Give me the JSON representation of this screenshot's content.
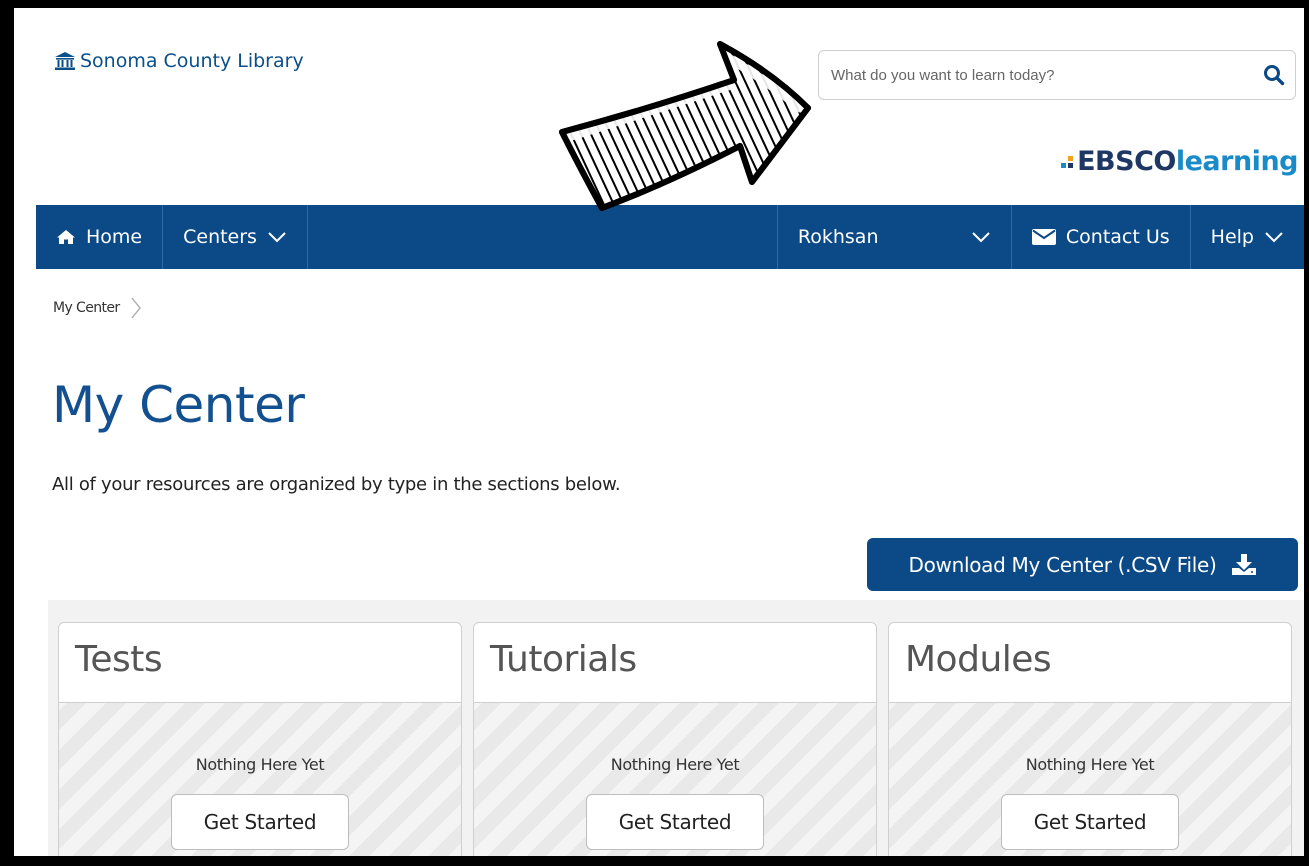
{
  "header": {
    "library_name": "Sonoma County Library",
    "search_placeholder": "What do you want to learn today?",
    "brand_prefix": "EBSCO",
    "brand_suffix": "learning"
  },
  "nav": {
    "home": "Home",
    "centers": "Centers",
    "user": "Rokhsan",
    "contact": "Contact Us",
    "help": "Help"
  },
  "breadcrumb": {
    "current": "My Center"
  },
  "page": {
    "title": "My Center",
    "subtitle": "All of your resources are organized by type in the sections below.",
    "download_label": "Download My Center (.CSV File)"
  },
  "cards": [
    {
      "title": "Tests",
      "empty_text": "Nothing Here Yet",
      "button": "Get Started"
    },
    {
      "title": "Tutorials",
      "empty_text": "Nothing Here Yet",
      "button": "Get Started"
    },
    {
      "title": "Modules",
      "empty_text": "Nothing Here Yet",
      "button": "Get Started"
    }
  ],
  "colors": {
    "primary": "#0b4a87",
    "title": "#13508f",
    "brand_dark": "#1e3764",
    "brand_light": "#1a8bc9"
  }
}
